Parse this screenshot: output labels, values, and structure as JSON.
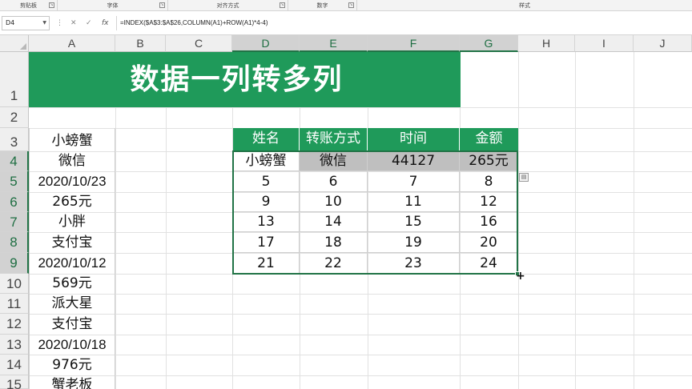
{
  "ribbon": {
    "groups": [
      {
        "label": "剪贴板"
      },
      {
        "label": "字体"
      },
      {
        "label": "对齐方式"
      },
      {
        "label": "数字"
      },
      {
        "label": "样式"
      }
    ]
  },
  "formula_bar": {
    "name_box": "D4",
    "cancel_icon": "✕",
    "enter_icon": "✓",
    "fx_label": "fx",
    "formula": "=INDEX($A$3:$A$26,COLUMN(A1)+ROW(A1)*4-4)"
  },
  "columns": [
    "A",
    "B",
    "C",
    "D",
    "E",
    "F",
    "G",
    "H",
    "I",
    "J"
  ],
  "rows": [
    "1",
    "2",
    "3",
    "4",
    "5",
    "6",
    "7",
    "8",
    "9",
    "10",
    "11",
    "12",
    "13",
    "14",
    "15"
  ],
  "title": "数据一列转多列",
  "column_a": [
    "小螃蟹",
    "微信",
    "2020/10/23",
    "265元",
    "小胖",
    "支付宝",
    "2020/10/12",
    "569元",
    "派大星",
    "支付宝",
    "2020/10/18",
    "976元",
    "蟹老板"
  ],
  "table": {
    "headers": [
      "姓名",
      "转账方式",
      "时间",
      "金额"
    ],
    "rows": [
      [
        "小螃蟹",
        "微信",
        "44127",
        "265元"
      ],
      [
        "5",
        "6",
        "7",
        "8"
      ],
      [
        "9",
        "10",
        "11",
        "12"
      ],
      [
        "13",
        "14",
        "15",
        "16"
      ],
      [
        "17",
        "18",
        "19",
        "20"
      ],
      [
        "21",
        "22",
        "23",
        "24"
      ]
    ]
  },
  "colors": {
    "accent_green": "#1f9a5a",
    "selection_green": "#217346",
    "gray_fill": "#bfbfbf"
  }
}
